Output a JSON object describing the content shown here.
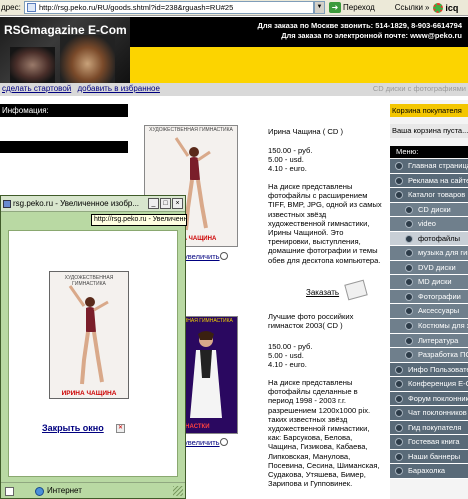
{
  "browser": {
    "address_label": "дрес:",
    "url": "http://rsg.peko.ru/RU/goods.shtml?id=238&rguash=RU#25",
    "go_label": "Переход",
    "links_label": "Ссылки",
    "icq_label": "icq"
  },
  "header": {
    "site_title": "RSGmagazine E-Com",
    "phone_line": "Для заказа по Москве звонить: 514-1829, 8-903-6614794",
    "email_line": "Для заказа по электронной почте: www@peko.ru",
    "dvd_label": "CD диски с фотографиями"
  },
  "links": {
    "make_home": "сделать стартовой",
    "add_favorites": "добавить в избранное"
  },
  "left": {
    "info_title": "Инфомация:"
  },
  "products": [
    {
      "image_caption": "ХУДОЖЕСТВЕННАЯ ГИМНАСТИКА",
      "image_name": "ИРИНА ЧАЩИНА",
      "enlarge": "увеличить",
      "title": "Ирина Чащина ( CD )",
      "price_rub": "150.00 - руб.",
      "price_usd": "5.00 - usd.",
      "price_eur": "4.10 - euro.",
      "description": "На диске представлены фотофайлы с расширением TIFF, BMP, JPG, одной из самых известных звёзд художественной гимнастики, Ирины Чащиной. Это тренировки, выступления, домашние фотографии и темы обев для десктопа компьютера.",
      "order": "Заказать"
    },
    {
      "image_caption": "ХУДОЖЕСТВЕННАЯ ГИМНАСТИКА",
      "image_name": "ГИМНАСТКИ",
      "enlarge": "увеличить",
      "title": "Лучшие фото российких гимнасток 2003( CD )",
      "price_rub": "150.00 - руб.",
      "price_usd": "5.00 - usd.",
      "price_eur": "4.10 - euro.",
      "description": "На диске представлены фотофайлы сделанные в период 1998 - 2003 г.г. разрешением 1200x1000 pix. таких известных звёзд художественной гимнастики, как: Барсукова, Белова, Чащина, Гизикова, Кабаева, Липковская, Манулова, Посевина, Сесина, Шиманская, Судакова, Утяшева, Бимер, Зарипова и Гупповинек."
    }
  ],
  "right": {
    "cart_title": "Корзина покупателя",
    "cart_empty": "Ваша корзина пуста...",
    "menu_title": "Меню:",
    "menu": [
      {
        "label": "Главная страница",
        "sub": false
      },
      {
        "label": "Реклама на сайте",
        "sub": false
      },
      {
        "label": "Каталог товаров",
        "sub": false
      },
      {
        "label": "CD диски",
        "sub": true
      },
      {
        "label": "video",
        "sub": true
      },
      {
        "label": "фотофайлы",
        "sub": true
      },
      {
        "label": "музыка для гимнастики",
        "sub": true
      },
      {
        "label": "DVD диски",
        "sub": true
      },
      {
        "label": "MD диски",
        "sub": true
      },
      {
        "label": "Фотографии",
        "sub": true
      },
      {
        "label": "Аксессуары",
        "sub": true
      },
      {
        "label": "Костюмы для художественной гимнастики",
        "sub": true
      },
      {
        "label": "Литература",
        "sub": true
      },
      {
        "label": "Разработка ПО",
        "sub": true
      },
      {
        "label": "Инфо Пользователя",
        "sub": false
      },
      {
        "label": "Конференция E-Com",
        "sub": false
      },
      {
        "label": "Форум поклонников",
        "sub": false
      },
      {
        "label": "Чат поклонников",
        "sub": false
      },
      {
        "label": "Гид покупателя",
        "sub": false
      },
      {
        "label": "Гостевая книга",
        "sub": false
      },
      {
        "label": "Наши баннеры",
        "sub": false
      },
      {
        "label": "Барахолка",
        "sub": false
      }
    ]
  },
  "popup": {
    "title": "rsg.peko.ru - Увеличенное изобр...",
    "url_tooltip": "http://rsg.peko.ru - Увеличенное",
    "image_caption": "ХУДОЖЕСТВЕННАЯ ГИМНАСТИКА",
    "image_name": "ИРИНА ЧАЩИНА",
    "close_link": "Закрыть окно",
    "status": "Интернет"
  }
}
